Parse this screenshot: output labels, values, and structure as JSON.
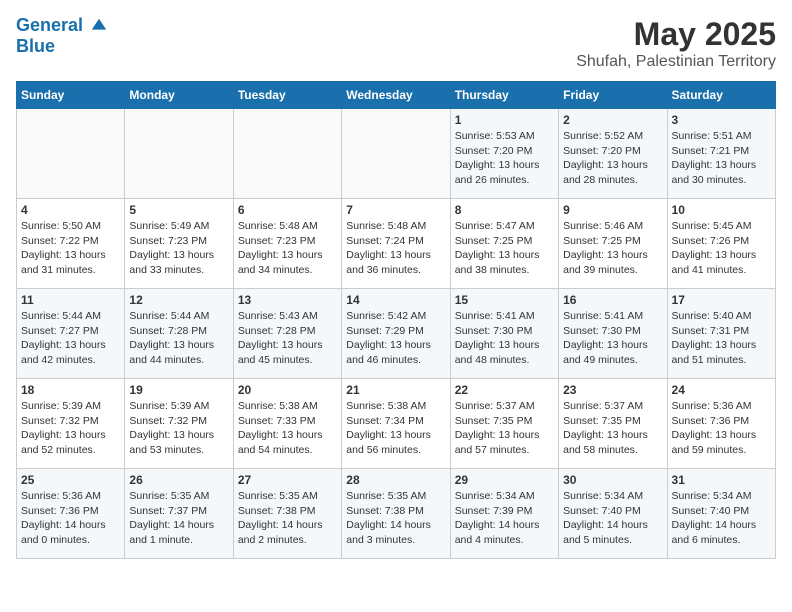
{
  "header": {
    "logo_line1": "General",
    "logo_line2": "Blue",
    "title": "May 2025",
    "subtitle": "Shufah, Palestinian Territory"
  },
  "weekdays": [
    "Sunday",
    "Monday",
    "Tuesday",
    "Wednesday",
    "Thursday",
    "Friday",
    "Saturday"
  ],
  "weeks": [
    [
      {
        "day": "",
        "info": ""
      },
      {
        "day": "",
        "info": ""
      },
      {
        "day": "",
        "info": ""
      },
      {
        "day": "",
        "info": ""
      },
      {
        "day": "1",
        "info": "Sunrise: 5:53 AM\nSunset: 7:20 PM\nDaylight: 13 hours and 26 minutes."
      },
      {
        "day": "2",
        "info": "Sunrise: 5:52 AM\nSunset: 7:20 PM\nDaylight: 13 hours and 28 minutes."
      },
      {
        "day": "3",
        "info": "Sunrise: 5:51 AM\nSunset: 7:21 PM\nDaylight: 13 hours and 30 minutes."
      }
    ],
    [
      {
        "day": "4",
        "info": "Sunrise: 5:50 AM\nSunset: 7:22 PM\nDaylight: 13 hours and 31 minutes."
      },
      {
        "day": "5",
        "info": "Sunrise: 5:49 AM\nSunset: 7:23 PM\nDaylight: 13 hours and 33 minutes."
      },
      {
        "day": "6",
        "info": "Sunrise: 5:48 AM\nSunset: 7:23 PM\nDaylight: 13 hours and 34 minutes."
      },
      {
        "day": "7",
        "info": "Sunrise: 5:48 AM\nSunset: 7:24 PM\nDaylight: 13 hours and 36 minutes."
      },
      {
        "day": "8",
        "info": "Sunrise: 5:47 AM\nSunset: 7:25 PM\nDaylight: 13 hours and 38 minutes."
      },
      {
        "day": "9",
        "info": "Sunrise: 5:46 AM\nSunset: 7:25 PM\nDaylight: 13 hours and 39 minutes."
      },
      {
        "day": "10",
        "info": "Sunrise: 5:45 AM\nSunset: 7:26 PM\nDaylight: 13 hours and 41 minutes."
      }
    ],
    [
      {
        "day": "11",
        "info": "Sunrise: 5:44 AM\nSunset: 7:27 PM\nDaylight: 13 hours and 42 minutes."
      },
      {
        "day": "12",
        "info": "Sunrise: 5:44 AM\nSunset: 7:28 PM\nDaylight: 13 hours and 44 minutes."
      },
      {
        "day": "13",
        "info": "Sunrise: 5:43 AM\nSunset: 7:28 PM\nDaylight: 13 hours and 45 minutes."
      },
      {
        "day": "14",
        "info": "Sunrise: 5:42 AM\nSunset: 7:29 PM\nDaylight: 13 hours and 46 minutes."
      },
      {
        "day": "15",
        "info": "Sunrise: 5:41 AM\nSunset: 7:30 PM\nDaylight: 13 hours and 48 minutes."
      },
      {
        "day": "16",
        "info": "Sunrise: 5:41 AM\nSunset: 7:30 PM\nDaylight: 13 hours and 49 minutes."
      },
      {
        "day": "17",
        "info": "Sunrise: 5:40 AM\nSunset: 7:31 PM\nDaylight: 13 hours and 51 minutes."
      }
    ],
    [
      {
        "day": "18",
        "info": "Sunrise: 5:39 AM\nSunset: 7:32 PM\nDaylight: 13 hours and 52 minutes."
      },
      {
        "day": "19",
        "info": "Sunrise: 5:39 AM\nSunset: 7:32 PM\nDaylight: 13 hours and 53 minutes."
      },
      {
        "day": "20",
        "info": "Sunrise: 5:38 AM\nSunset: 7:33 PM\nDaylight: 13 hours and 54 minutes."
      },
      {
        "day": "21",
        "info": "Sunrise: 5:38 AM\nSunset: 7:34 PM\nDaylight: 13 hours and 56 minutes."
      },
      {
        "day": "22",
        "info": "Sunrise: 5:37 AM\nSunset: 7:35 PM\nDaylight: 13 hours and 57 minutes."
      },
      {
        "day": "23",
        "info": "Sunrise: 5:37 AM\nSunset: 7:35 PM\nDaylight: 13 hours and 58 minutes."
      },
      {
        "day": "24",
        "info": "Sunrise: 5:36 AM\nSunset: 7:36 PM\nDaylight: 13 hours and 59 minutes."
      }
    ],
    [
      {
        "day": "25",
        "info": "Sunrise: 5:36 AM\nSunset: 7:36 PM\nDaylight: 14 hours and 0 minutes."
      },
      {
        "day": "26",
        "info": "Sunrise: 5:35 AM\nSunset: 7:37 PM\nDaylight: 14 hours and 1 minute."
      },
      {
        "day": "27",
        "info": "Sunrise: 5:35 AM\nSunset: 7:38 PM\nDaylight: 14 hours and 2 minutes."
      },
      {
        "day": "28",
        "info": "Sunrise: 5:35 AM\nSunset: 7:38 PM\nDaylight: 14 hours and 3 minutes."
      },
      {
        "day": "29",
        "info": "Sunrise: 5:34 AM\nSunset: 7:39 PM\nDaylight: 14 hours and 4 minutes."
      },
      {
        "day": "30",
        "info": "Sunrise: 5:34 AM\nSunset: 7:40 PM\nDaylight: 14 hours and 5 minutes."
      },
      {
        "day": "31",
        "info": "Sunrise: 5:34 AM\nSunset: 7:40 PM\nDaylight: 14 hours and 6 minutes."
      }
    ]
  ]
}
